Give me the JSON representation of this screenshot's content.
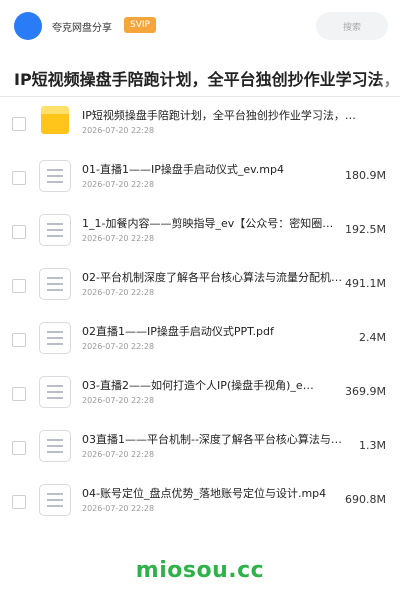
{
  "header": {
    "brand": "夸克网盘分享",
    "badge": "SVIP",
    "search_placeholder": "搜索"
  },
  "title": "IP短视频操盘手陪跑计划，全平台独创抄作业学习法，转型",
  "files": [
    {
      "type": "folder",
      "name": "IP短视频操盘手陪跑计划，全平台独创抄作业学习法，…",
      "date": "2026-07-20 22:28",
      "size": ""
    },
    {
      "type": "file",
      "name": "01-直播1——IP操盘手启动仪式_ev.mp4",
      "date": "2026-07-20 22:28",
      "size": "180.9M"
    },
    {
      "type": "file",
      "name": "1_1-加餐内容——剪映指导_ev【公众号：密知圈…",
      "date": "2026-07-20 22:28",
      "size": "192.5M"
    },
    {
      "type": "file",
      "name": "02-平台机制深度了解各平台核心算法与流量分配机制…",
      "date": "2026-07-20 22:28",
      "size": "491.1M"
    },
    {
      "type": "file",
      "name": "02直播1——IP操盘手启动仪式PPT.pdf",
      "date": "2026-07-20 22:28",
      "size": "2.4M"
    },
    {
      "type": "file",
      "name": "03-直播2——如何打造个人IP(操盘手视角)_e…",
      "date": "2026-07-20 22:28",
      "size": "369.9M"
    },
    {
      "type": "file",
      "name": "03直播1——平台机制--深度了解各平台核心算法与…",
      "date": "2026-07-20 22:28",
      "size": "1.3M"
    },
    {
      "type": "file",
      "name": "04-账号定位_盘点优势_落地账号定位与设计.mp4",
      "date": "2026-07-20 22:28",
      "size": "690.8M"
    }
  ],
  "footer": "miosou.cc",
  "colors": {
    "accent": "#2a7cf6",
    "svip": "#f4a63a",
    "folder": "#ffc51a",
    "footer": "#2fb24a"
  }
}
